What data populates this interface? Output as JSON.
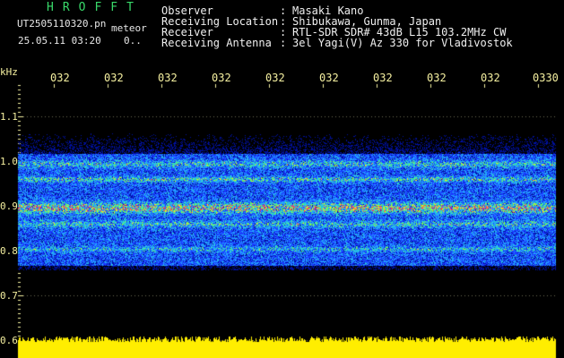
{
  "header": {
    "app_title": "HROFFT",
    "file_name": "UT2505110320.pn",
    "tag": "meteor",
    "date_time": "25.05.11 03:20",
    "date_suffix": "0.."
  },
  "meta": [
    {
      "label": "Observer",
      "value": "Masaki Kano"
    },
    {
      "label": "Receiving Location",
      "value": "Shibukawa, Gunma, Japan"
    },
    {
      "label": "Receiver",
      "value": "RTL-SDR SDR# 43dB L15 103.2MHz CW"
    },
    {
      "label": "Receiving Antenna",
      "value": "3el Yagi(V) Az 330 for Vladivostok"
    }
  ],
  "separator": ":",
  "x_axis": {
    "ticks": [
      "032",
      "032",
      "032",
      "032",
      "032",
      "032",
      "032",
      "032",
      "032",
      "0330"
    ]
  },
  "y_axis": {
    "unit": "kHz",
    "ticks": [
      "1.1",
      "1.0",
      "0.9",
      "0.8",
      "0.7",
      "0.6"
    ]
  },
  "colors": {
    "background": "#000000",
    "title_green": "#39d96a",
    "axis_label": "#f5f0a0",
    "amplitude": "#ffee00",
    "noise_blue": "#1a3cff"
  }
}
